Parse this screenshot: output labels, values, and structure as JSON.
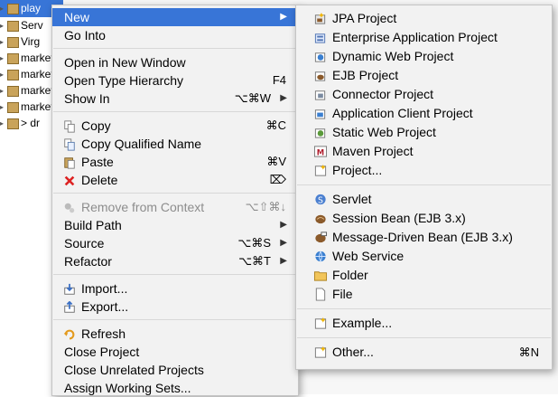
{
  "tree": {
    "rows": [
      {
        "label": "play",
        "icon": "web-project-icon"
      },
      {
        "label": "Serv",
        "icon": "servers-folder-icon"
      },
      {
        "label": "Virg",
        "icon": "virgo-server-icon"
      },
      {
        "label": "market",
        "icon": "project-folder-icon"
      },
      {
        "label": "market",
        "icon": "project-folder-icon"
      },
      {
        "label": "market",
        "icon": "project-folder-icon"
      },
      {
        "label": "market",
        "icon": "project-folder-icon"
      },
      {
        "label": "> dr",
        "icon": "maven-project-icon"
      }
    ]
  },
  "context_menu": {
    "items": [
      {
        "label": "New",
        "has_submenu": true,
        "highlighted": true
      },
      {
        "label": "Go Into"
      },
      {
        "separator": true
      },
      {
        "label": "Open in New Window"
      },
      {
        "label": "Open Type Hierarchy",
        "shortcut": "F4"
      },
      {
        "label": "Show In",
        "shortcut": "⌥⌘W",
        "has_submenu": true
      },
      {
        "separator": true
      },
      {
        "label": "Copy",
        "shortcut": "⌘C",
        "icon": "copy-icon"
      },
      {
        "label": "Copy Qualified Name",
        "icon": "copy-qualified-name-icon"
      },
      {
        "label": "Paste",
        "shortcut": "⌘V",
        "icon": "paste-icon"
      },
      {
        "label": "Delete",
        "shortcut": "⌦",
        "icon": "delete-icon"
      },
      {
        "separator": true
      },
      {
        "label": "Remove from Context",
        "shortcut": "⌥⇧⌘↓",
        "icon": "remove-context-icon",
        "disabled": true
      },
      {
        "label": "Build Path",
        "has_submenu": true
      },
      {
        "label": "Source",
        "shortcut": "⌥⌘S",
        "has_submenu": true
      },
      {
        "label": "Refactor",
        "shortcut": "⌥⌘T",
        "has_submenu": true
      },
      {
        "separator": true
      },
      {
        "label": "Import...",
        "icon": "import-icon"
      },
      {
        "label": "Export...",
        "icon": "export-icon"
      },
      {
        "separator": true
      },
      {
        "label": "Refresh",
        "icon": "refresh-icon"
      },
      {
        "label": "Close Project"
      },
      {
        "label": "Close Unrelated Projects"
      },
      {
        "label": "Assign Working Sets..."
      }
    ]
  },
  "new_submenu": {
    "items": [
      {
        "label": "JPA Project",
        "icon": "jpa-project-icon"
      },
      {
        "label": "Enterprise Application Project",
        "icon": "enterprise-app-icon"
      },
      {
        "label": "Dynamic Web Project",
        "icon": "dynamic-web-icon"
      },
      {
        "label": "EJB Project",
        "icon": "ejb-project-icon"
      },
      {
        "label": "Connector Project",
        "icon": "connector-project-icon"
      },
      {
        "label": "Application Client Project",
        "icon": "app-client-icon"
      },
      {
        "label": "Static Web Project",
        "icon": "static-web-icon"
      },
      {
        "label": "Maven Project",
        "icon": "maven-icon"
      },
      {
        "label": "Project...",
        "icon": "project-icon"
      },
      {
        "separator": true
      },
      {
        "label": "Servlet",
        "icon": "servlet-icon"
      },
      {
        "label": "Session Bean (EJB 3.x)",
        "icon": "session-bean-icon"
      },
      {
        "label": "Message-Driven Bean (EJB 3.x)",
        "icon": "message-bean-icon"
      },
      {
        "label": "Web Service",
        "icon": "web-service-icon"
      },
      {
        "label": "Folder",
        "icon": "folder-icon"
      },
      {
        "label": "File",
        "icon": "file-icon"
      },
      {
        "separator": true
      },
      {
        "label": "Example...",
        "icon": "example-icon"
      },
      {
        "separator": true
      },
      {
        "label": "Other...",
        "shortcut": "⌘N",
        "icon": "other-icon"
      }
    ]
  },
  "colors": {
    "highlight": "#3875d7",
    "menu_bg": "#f2f2f2",
    "separator": "#d8d8d8",
    "disabled_text": "#8d8d8d"
  }
}
